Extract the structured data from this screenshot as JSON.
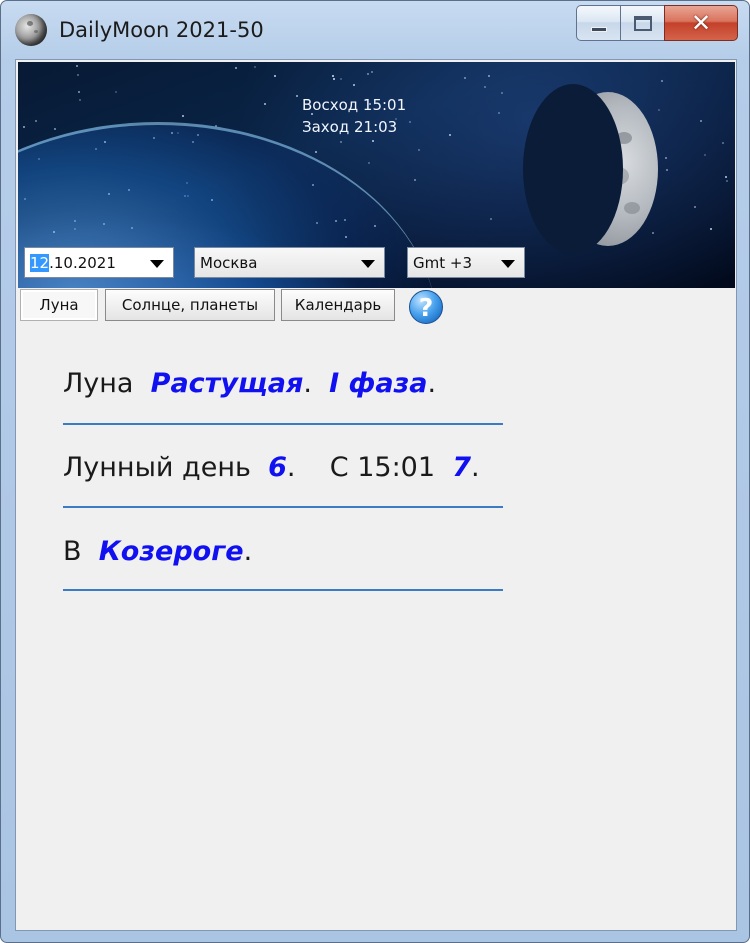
{
  "window": {
    "title": "DailyMoon 2021-50",
    "icon": "moon-icon",
    "controls": {
      "minimize": "minimize-icon",
      "maximize": "maximize-icon",
      "close": "close-icon"
    }
  },
  "banner": {
    "sunrise": "Восход 15:01",
    "sunset": "Заход 21:03"
  },
  "selectors": {
    "date": {
      "day": "12",
      "rest": ".10.2021"
    },
    "city": "Москва",
    "timezone": "Gmt +3"
  },
  "tabs": [
    {
      "label": "Луна",
      "active": true
    },
    {
      "label": "Солнце, планеты",
      "active": false
    },
    {
      "label": "Календарь",
      "active": false
    }
  ],
  "help": {
    "glyph": "?",
    "icon": "help-icon"
  },
  "info": {
    "line1": {
      "prefix": "Луна",
      "phase_name": "Растущая",
      "dot1": ".",
      "phase_number": "I фаза",
      "dot2": "."
    },
    "line2": {
      "prefix": "Лунный день",
      "day": "6",
      "dot1": ".",
      "since": "С 15:01",
      "next_day": "7",
      "dot2": "."
    },
    "line3": {
      "prefix": "В",
      "sign": "Козероге",
      "dot": "."
    }
  },
  "colors": {
    "highlight": "#1010f0",
    "rule": "#3b7bc4",
    "selection": "#3399ff"
  }
}
